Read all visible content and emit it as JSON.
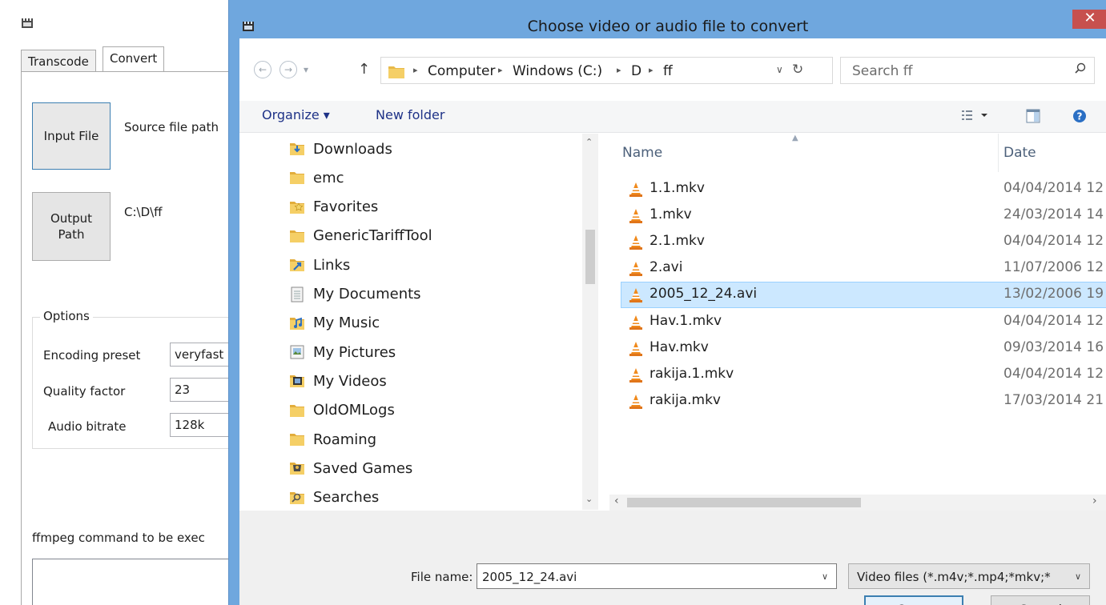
{
  "bg_app": {
    "tabs": [
      "Transcode",
      "Convert"
    ],
    "input_file_label": "Input File",
    "source_path_text": "Source file path",
    "output_path_label": "Output Path",
    "output_path_value": "C:\\D\\ff",
    "options_title": "Options",
    "encoding_preset_label": "Encoding preset",
    "encoding_preset_value": "veryfast",
    "quality_factor_label": "Quality factor",
    "quality_factor_value": "23",
    "audio_bitrate_label": "Audio bitrate",
    "audio_bitrate_value": "128k",
    "command_label": "ffmpeg command to be exec"
  },
  "dialog": {
    "title": "Choose video or audio file to convert",
    "close_glyph": "✕",
    "breadcrumb": [
      "Computer",
      "Windows (C:)",
      "D",
      "ff"
    ],
    "search_placeholder": "Search ff",
    "toolbar": {
      "organize": "Organize ▾",
      "new_folder": "New folder"
    },
    "nav_items": [
      {
        "label": "Downloads",
        "icon": "downloads-folder-icon"
      },
      {
        "label": "emc",
        "icon": "folder-icon"
      },
      {
        "label": "Favorites",
        "icon": "favorites-folder-icon"
      },
      {
        "label": "GenericTariffTool",
        "icon": "folder-icon"
      },
      {
        "label": "Links",
        "icon": "links-folder-icon"
      },
      {
        "label": "My Documents",
        "icon": "documents-icon"
      },
      {
        "label": "My Music",
        "icon": "music-folder-icon"
      },
      {
        "label": "My Pictures",
        "icon": "pictures-folder-icon"
      },
      {
        "label": "My Videos",
        "icon": "videos-folder-icon"
      },
      {
        "label": "OldOMLogs",
        "icon": "folder-icon"
      },
      {
        "label": "Roaming",
        "icon": "folder-icon"
      },
      {
        "label": "Saved Games",
        "icon": "saved-games-icon"
      },
      {
        "label": "Searches",
        "icon": "searches-folder-icon"
      }
    ],
    "columns": {
      "name": "Name",
      "date": "Date"
    },
    "files": [
      {
        "name": "1.1.mkv",
        "date": "04/04/2014 12"
      },
      {
        "name": "1.mkv",
        "date": "24/03/2014 14"
      },
      {
        "name": "2.1.mkv",
        "date": "04/04/2014 12"
      },
      {
        "name": "2.avi",
        "date": "11/07/2006 12"
      },
      {
        "name": "2005_12_24.avi",
        "date": "13/02/2006 19",
        "selected": true
      },
      {
        "name": "Hav.1.mkv",
        "date": "04/04/2014 12"
      },
      {
        "name": "Hav.mkv",
        "date": "09/03/2014 16"
      },
      {
        "name": "rakija.1.mkv",
        "date": "04/04/2014 12"
      },
      {
        "name": "rakija.mkv",
        "date": "17/03/2014 21"
      }
    ],
    "file_name_label": "File name:",
    "file_name_value": "2005_12_24.avi",
    "file_type_value": "Video files (*.m4v;*.mp4;*mkv;*",
    "open_label": "Open",
    "cancel_label": "Cancel"
  },
  "colors": {
    "titlebar": "#6fa7de",
    "close": "#c7504e",
    "selection": "#cce8ff",
    "folder": "#e8b949"
  }
}
